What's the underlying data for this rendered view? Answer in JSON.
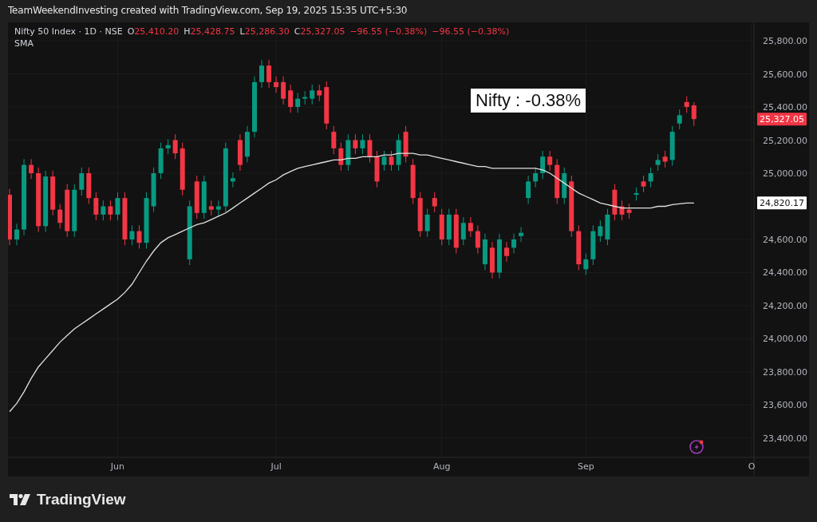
{
  "header": {
    "title": "TeamWeekendInvesting created with TradingView.com, Sep 19, 2025 15:35 UTC+5:30"
  },
  "legend": {
    "symbol": "Nifty 50 Index · 1D · NSE",
    "ohlc": [
      {
        "label": "O",
        "value": "25,410.20"
      },
      {
        "label": "H",
        "value": "25,428.75"
      },
      {
        "label": "L",
        "value": "25,286.30"
      },
      {
        "label": "C",
        "value": "25,327.05"
      }
    ],
    "changes": [
      "−96.55 (−0.38%)",
      "−96.55 (−0.38%)"
    ]
  },
  "chart": {
    "chart_data": {
      "type": "candlestick",
      "grid": true,
      "ylim": [
        23284,
        25911
      ],
      "categories": [
        null,
        null,
        null,
        null,
        null,
        null,
        null,
        null,
        null,
        null,
        null,
        null,
        null,
        null,
        null,
        "Jun",
        null,
        null,
        null,
        null,
        null,
        null,
        null,
        null,
        null,
        null,
        null,
        null,
        null,
        null,
        null,
        null,
        null,
        null,
        null,
        null,
        null,
        "Jul",
        null,
        null,
        null,
        null,
        null,
        null,
        null,
        null,
        null,
        null,
        null,
        null,
        null,
        null,
        null,
        null,
        null,
        null,
        null,
        null,
        null,
        null,
        "Aug",
        null,
        null,
        null,
        null,
        null,
        null,
        null,
        null,
        null,
        null,
        null,
        null,
        null,
        null,
        null,
        null,
        null,
        null,
        null,
        "Sep",
        null,
        null,
        null,
        null,
        null,
        null,
        null,
        null,
        null,
        null,
        null,
        null,
        null,
        null,
        null,
        null,
        null,
        null,
        null,
        null,
        null,
        null,
        "O"
      ],
      "yticks": [
        {
          "value": 25800,
          "label": "25,800.00"
        },
        {
          "value": 25600,
          "label": "25,600.00"
        },
        {
          "value": 25400,
          "label": "25,400.00"
        },
        {
          "value": 25200,
          "label": "25,200.00"
        },
        {
          "value": 25000,
          "label": "25,000.00"
        },
        {
          "value": 24600,
          "label": "24,600.00"
        },
        {
          "value": 24400,
          "label": "24,400.00"
        },
        {
          "value": 24200,
          "label": "24,200.00"
        },
        {
          "value": 24000,
          "label": "24,000.00"
        },
        {
          "value": 23800,
          "label": "23,800.00"
        },
        {
          "value": 23600,
          "label": "23,600.00"
        },
        {
          "value": 23400,
          "label": "23,400.00"
        }
      ],
      "ohlc": [
        [
          24870,
          24905,
          24565,
          24600
        ],
        [
          24600,
          24695,
          24565,
          24660
        ],
        [
          24660,
          25085,
          24625,
          25050
        ],
        [
          25050,
          25085,
          24965,
          25000
        ],
        [
          25000,
          25035,
          24645,
          24680
        ],
        [
          24680,
          25015,
          24645,
          24980
        ],
        [
          24980,
          25015,
          24745,
          24780
        ],
        [
          24780,
          24815,
          24665,
          24700
        ],
        [
          24900,
          24935,
          24615,
          24650
        ],
        [
          24650,
          24935,
          24615,
          24900
        ],
        [
          24900,
          25035,
          24865,
          25000
        ],
        [
          25000,
          25035,
          24815,
          24850
        ],
        [
          24850,
          24885,
          24715,
          24750
        ],
        [
          24750,
          24835,
          24715,
          24800
        ],
        [
          24800,
          24835,
          24715,
          24750
        ],
        [
          24750,
          24885,
          24715,
          24850
        ],
        [
          24850,
          24885,
          24565,
          24600
        ],
        [
          24600,
          24685,
          24565,
          24650
        ],
        [
          24650,
          24685,
          24545,
          24580
        ],
        [
          24580,
          24885,
          24545,
          24850
        ],
        [
          24800,
          25035,
          24765,
          25000
        ],
        [
          25000,
          25185,
          24965,
          25150
        ],
        [
          25150,
          25205,
          25115,
          25170
        ],
        [
          25200,
          25235,
          25085,
          25120
        ],
        [
          25150,
          25185,
          24865,
          24900
        ],
        [
          24480,
          24835,
          24445,
          24800
        ],
        [
          24950,
          24985,
          24725,
          24760
        ],
        [
          24760,
          24985,
          24725,
          24950
        ],
        [
          24800,
          24835,
          24745,
          24780
        ],
        [
          24780,
          24835,
          24745,
          24800
        ],
        [
          24800,
          25185,
          24765,
          25150
        ],
        [
          24950,
          25005,
          24915,
          24970
        ],
        [
          25200,
          25235,
          25015,
          25050
        ],
        [
          25100,
          25285,
          25065,
          25250
        ],
        [
          25250,
          25585,
          25215,
          25550
        ],
        [
          25550,
          25685,
          25515,
          25650
        ],
        [
          25650,
          25685,
          25515,
          25550
        ],
        [
          25550,
          25585,
          25485,
          25520
        ],
        [
          25550,
          25585,
          25415,
          25450
        ],
        [
          25500,
          25535,
          25365,
          25400
        ],
        [
          25400,
          25485,
          25365,
          25450
        ],
        [
          25450,
          25495,
          25415,
          25460
        ],
        [
          25450,
          25535,
          25415,
          25500
        ],
        [
          25500,
          25535,
          25435,
          25470
        ],
        [
          25520,
          25555,
          25265,
          25300
        ],
        [
          25250,
          25285,
          25115,
          25150
        ],
        [
          25150,
          25185,
          25015,
          25050
        ],
        [
          25050,
          25235,
          25015,
          25200
        ],
        [
          25200,
          25235,
          25115,
          25150
        ],
        [
          25150,
          25235,
          25115,
          25200
        ],
        [
          25200,
          25235,
          25065,
          25100
        ],
        [
          25100,
          25135,
          24915,
          24950
        ],
        [
          25050,
          25135,
          25015,
          25100
        ],
        [
          25100,
          25135,
          25015,
          25050
        ],
        [
          25050,
          25235,
          25015,
          25200
        ],
        [
          25250,
          25285,
          25065,
          25100
        ],
        [
          25050,
          25085,
          24815,
          24850
        ],
        [
          24850,
          24885,
          24615,
          24650
        ],
        [
          24650,
          24785,
          24615,
          24750
        ],
        [
          24850,
          24885,
          24765,
          24800
        ],
        [
          24750,
          24785,
          24565,
          24600
        ],
        [
          24600,
          24785,
          24565,
          24750
        ],
        [
          24750,
          24785,
          24515,
          24550
        ],
        [
          24600,
          24735,
          24565,
          24700
        ],
        [
          24700,
          24735,
          24615,
          24650
        ],
        [
          24650,
          24685,
          24515,
          24550
        ],
        [
          24450,
          24635,
          24415,
          24600
        ],
        [
          24550,
          24585,
          24365,
          24400
        ],
        [
          24400,
          24635,
          24365,
          24600
        ],
        [
          24550,
          24585,
          24465,
          24500
        ],
        [
          24550,
          24635,
          24515,
          24600
        ],
        [
          24620,
          24675,
          24585,
          24640
        ],
        [
          24850,
          24985,
          24815,
          24950
        ],
        [
          24950,
          25035,
          24915,
          25000
        ],
        [
          25000,
          25135,
          24965,
          25100
        ],
        [
          25100,
          25135,
          25015,
          25050
        ],
        [
          25050,
          25085,
          24815,
          24850
        ],
        [
          24850,
          25035,
          24815,
          25000
        ],
        [
          24950,
          24985,
          24615,
          24650
        ],
        [
          24650,
          24685,
          24415,
          24450
        ],
        [
          24420,
          24515,
          24385,
          24480
        ],
        [
          24480,
          24685,
          24445,
          24650
        ],
        [
          24620,
          24715,
          24585,
          24680
        ],
        [
          24600,
          24785,
          24565,
          24750
        ],
        [
          24900,
          24935,
          24715,
          24750
        ],
        [
          24800,
          24835,
          24715,
          24750
        ],
        [
          24780,
          24815,
          24725,
          24760
        ],
        [
          24870,
          24915,
          24835,
          24880
        ],
        [
          24950,
          24985,
          24885,
          24920
        ],
        [
          24950,
          25035,
          24915,
          25000
        ],
        [
          25050,
          25115,
          25015,
          25080
        ],
        [
          25100,
          25135,
          25035,
          25070
        ],
        [
          25080,
          25285,
          25045,
          25250
        ],
        [
          25300,
          25385,
          25265,
          25350
        ],
        [
          25430,
          25465,
          25365,
          25400
        ],
        [
          25410,
          25429,
          25286,
          25327
        ],
        null,
        null,
        null,
        null,
        null,
        null,
        null,
        null
      ],
      "series": [
        {
          "name": "SMA",
          "type": "line",
          "color": "#e0e0e0",
          "values": [
            23560,
            23610,
            23680,
            23760,
            23830,
            23880,
            23930,
            23980,
            24020,
            24060,
            24090,
            24120,
            24150,
            24180,
            24210,
            24240,
            24280,
            24330,
            24400,
            24470,
            24530,
            24580,
            24610,
            24630,
            24650,
            24670,
            24690,
            24700,
            24720,
            24740,
            24760,
            24790,
            24820,
            24850,
            24880,
            24910,
            24940,
            24960,
            24990,
            25010,
            25030,
            25040,
            25050,
            25060,
            25070,
            25080,
            25080,
            25090,
            25090,
            25100,
            25100,
            25100,
            25110,
            25110,
            25120,
            25120,
            25120,
            25110,
            25110,
            25100,
            25090,
            25080,
            25070,
            25060,
            25050,
            25040,
            25040,
            25030,
            25030,
            25030,
            25030,
            25030,
            25030,
            25030,
            25020,
            25000,
            24970,
            24940,
            24910,
            24880,
            24860,
            24840,
            24820,
            24810,
            24800,
            24790,
            24790,
            24790,
            24790,
            24790,
            24800,
            24800,
            24810,
            24815,
            24820,
            24820,
            null,
            null,
            null,
            null,
            null,
            null,
            null,
            null
          ]
        }
      ],
      "annotations": [
        {
          "text": "Nifty : -0.38%"
        }
      ]
    },
    "price_labels": [
      {
        "kind": "last",
        "text": "25,327.05"
      },
      {
        "kind": "sma",
        "text": "24,820.17"
      }
    ]
  },
  "footer": {
    "logo": "TradingView"
  }
}
